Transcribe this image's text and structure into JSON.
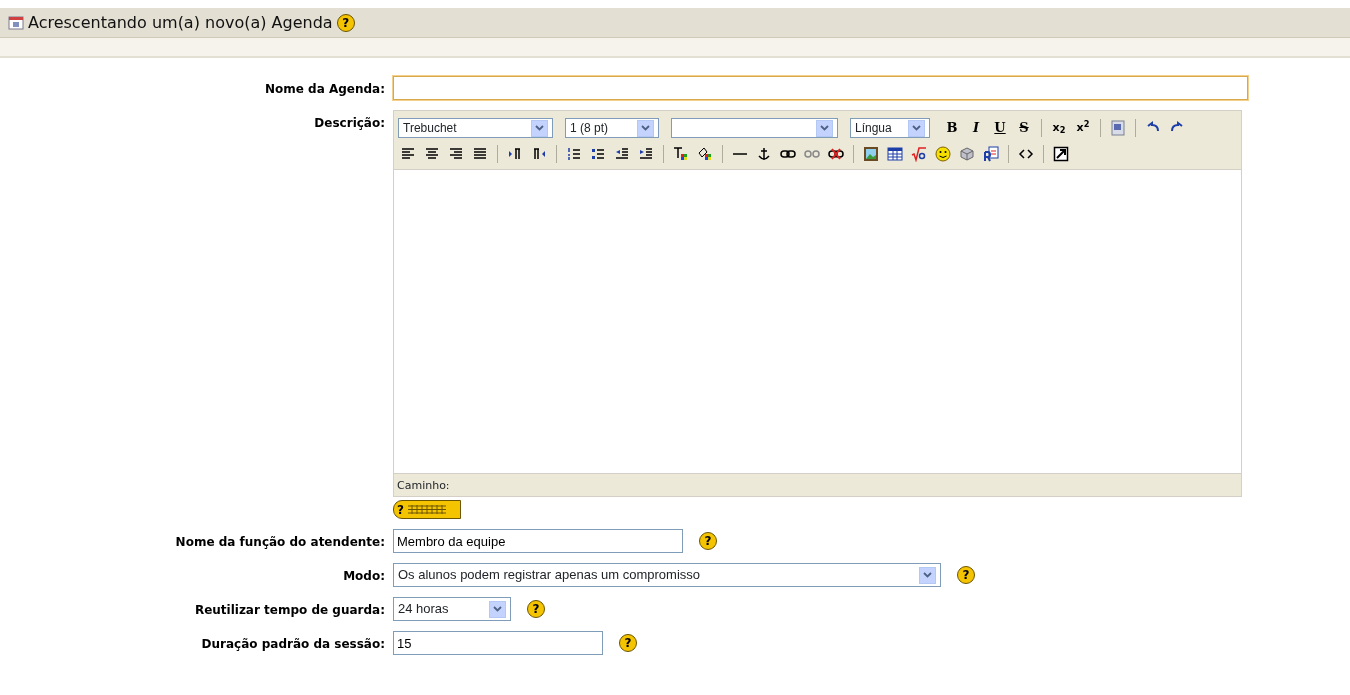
{
  "header": {
    "title": "Acrescentando um(a) novo(a) Agenda",
    "help": "?"
  },
  "fields": [
    {
      "kind": "text",
      "label": "Nome da Agenda:",
      "focused": true
    },
    {
      "kind": "editor",
      "label": "Descrição:",
      "path_label": "Caminho:",
      "keyboard_help": "?",
      "toolbar": [
        [
          {
            "kind": "select",
            "value": "Trebuchet"
          },
          {
            "kind": "select",
            "value": "1 (8 pt)"
          },
          {
            "kind": "select"
          },
          {
            "kind": "select",
            "value": "Língua"
          },
          {
            "kind": "text",
            "label": "B"
          },
          {
            "kind": "text",
            "label": "I"
          },
          {
            "kind": "text",
            "label": "U"
          },
          {
            "kind": "text",
            "label": "S"
          },
          {
            "kind": "sep"
          },
          {
            "kind": "text",
            "label": "x$_{2}$"
          },
          {
            "kind": "text",
            "label": "x$^{2}$"
          },
          {
            "kind": "sep"
          },
          {
            "kind": "icon"
          },
          {
            "kind": "sep"
          },
          {
            "kind": "icon"
          },
          {
            "kind": "icon"
          }
        ],
        [
          {
            "kind": "icon"
          },
          {
            "kind": "icon"
          },
          {
            "kind": "icon"
          },
          {
            "kind": "icon"
          },
          {
            "kind": "sep"
          },
          {
            "kind": "icon"
          },
          {
            "kind": "icon"
          },
          {
            "kind": "sep"
          },
          {
            "kind": "icon"
          },
          {
            "kind": "icon"
          },
          {
            "kind": "icon"
          },
          {
            "kind": "icon"
          },
          {
            "kind": "sep"
          },
          {
            "kind": "icon"
          },
          {
            "kind": "icon"
          },
          {
            "kind": "sep"
          },
          {
            "kind": "icon"
          },
          {
            "kind": "icon"
          },
          {
            "kind": "icon"
          },
          {
            "kind": "icon"
          },
          {
            "kind": "icon"
          },
          {
            "kind": "sep"
          },
          {
            "kind": "icon"
          },
          {
            "kind": "icon"
          },
          {
            "kind": "icon"
          },
          {
            "kind": "icon"
          },
          {
            "kind": "icon"
          },
          {
            "kind": "icon"
          },
          {
            "kind": "sep"
          },
          {
            "kind": "icon"
          },
          {
            "kind": "sep"
          },
          {
            "kind": "icon"
          }
        ]
      ]
    },
    {
      "kind": "text",
      "label": "Nome da função do atendente:",
      "value": "Membro da equipe",
      "help": "?",
      "focused": false
    },
    {
      "kind": "select",
      "label": "Modo:",
      "value": "Os alunos podem registrar apenas um compromisso",
      "help": "?"
    },
    {
      "kind": "select",
      "label": "Reutilizar tempo de guarda:",
      "value": "24 horas",
      "help": "?"
    },
    {
      "kind": "text",
      "label": "Duração padrão da sessão:",
      "value": "15",
      "help": "?",
      "focused": false
    }
  ]
}
